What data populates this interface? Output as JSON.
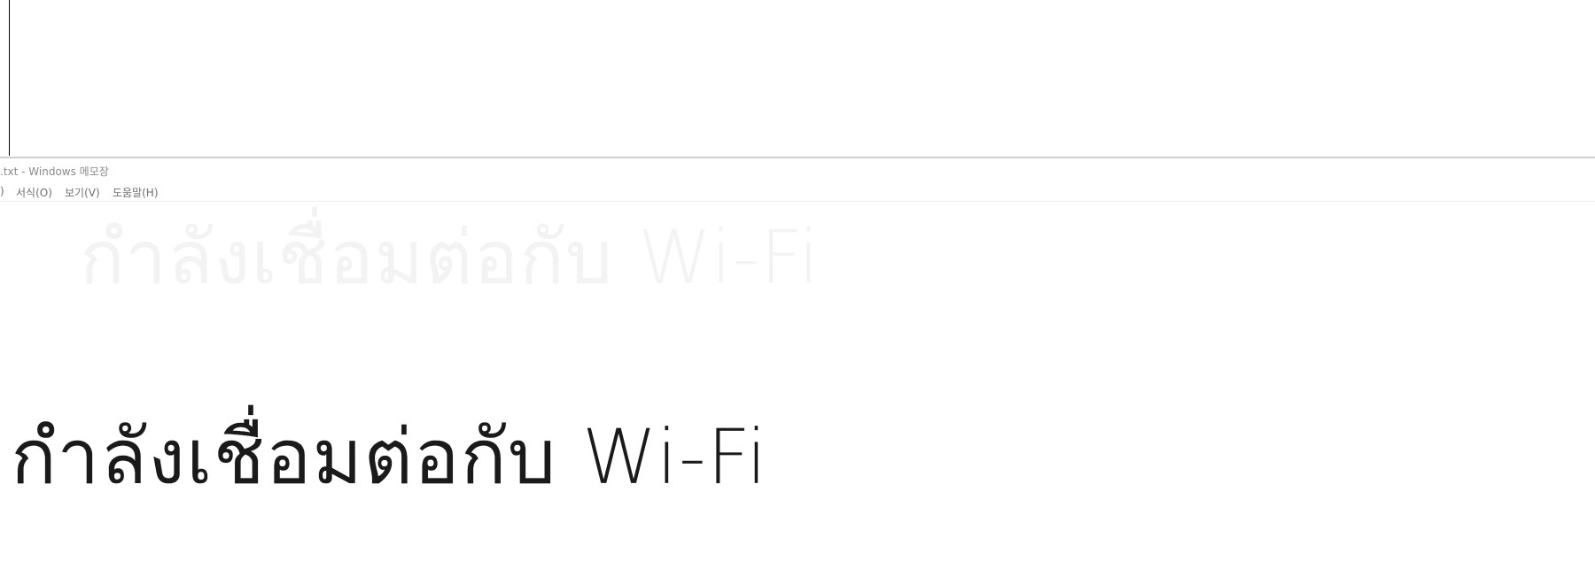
{
  "window": {
    "title": ".txt - Windows 메모장"
  },
  "menu": {
    "items": [
      {
        "label": ")"
      },
      {
        "label": "서식(O)"
      },
      {
        "label": "보기(V)"
      },
      {
        "label": "도움말(H)"
      }
    ]
  },
  "content": {
    "ghost_text": "กำลังเชื่อมต่อกับ Wi-Fi",
    "main_text": "กำลังเชื่อมต่อกับ Wi-Fi"
  }
}
